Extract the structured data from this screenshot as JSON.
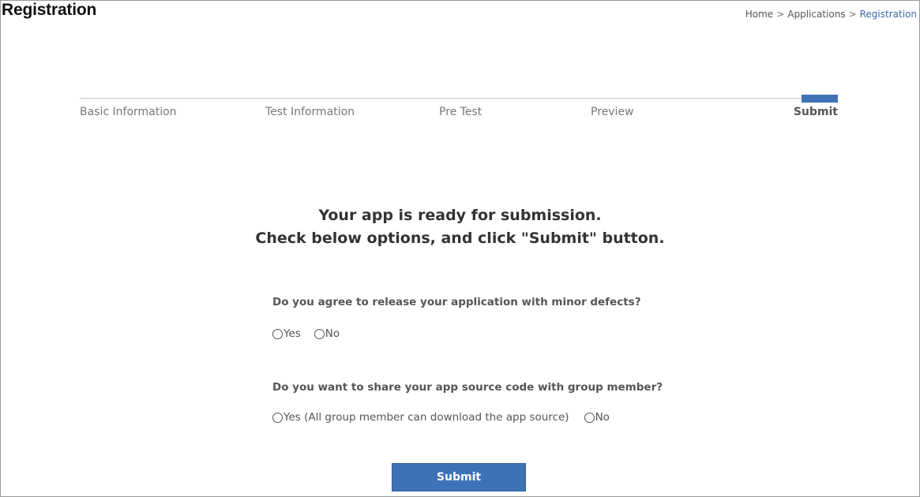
{
  "header": {
    "title": "Registration",
    "breadcrumb": [
      "Home",
      "Applications",
      "Registration"
    ],
    "breadcrumb_separator": ">"
  },
  "stepper": {
    "steps": [
      "Basic Information",
      "Test Information",
      "Pre Test",
      "Preview",
      "Submit"
    ],
    "active_step": "Submit"
  },
  "main": {
    "headline_line1": "Your app is ready for submission.",
    "headline_line2": "Check below options, and click \"Submit\" button.",
    "question1": {
      "label": "Do you agree to release your application with minor defects?",
      "options": [
        "Yes",
        "No"
      ]
    },
    "question2": {
      "label": "Do you want to share your app source code with group member?",
      "options": [
        "Yes (All group member can download the app source)",
        "No"
      ]
    },
    "submit_label": "Submit"
  },
  "colors": {
    "accent": "#3e72b7",
    "breadcrumb_current": "#3a6aa8"
  }
}
